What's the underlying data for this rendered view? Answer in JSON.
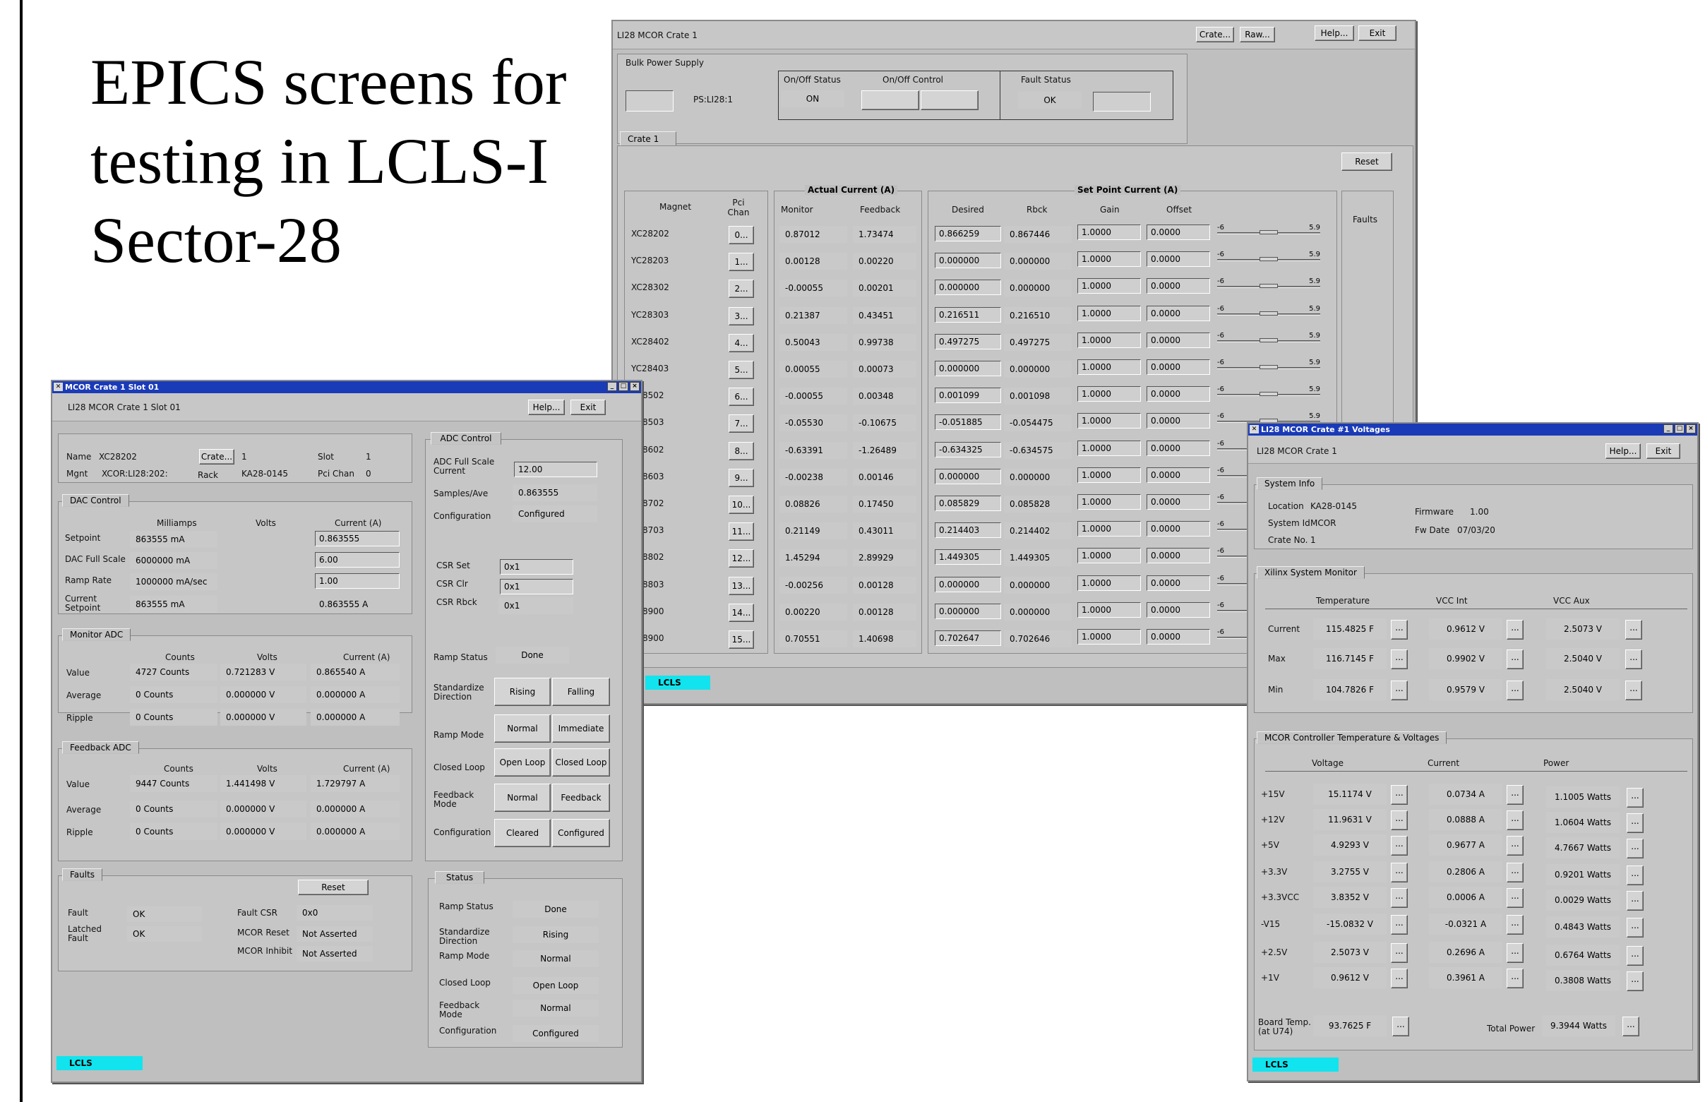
{
  "slide": {
    "title_lines": [
      "EPICS screens for",
      "testing in LCLS-I",
      "Sector-28"
    ]
  },
  "crate": {
    "title": "LI28 MCOR Crate 1",
    "buttons": [
      "Crate...",
      "Raw...",
      "Help...",
      "Exit"
    ],
    "bulk": {
      "label": "Bulk Power Supply",
      "ps_name": "PS:LI28:1",
      "onoff_status_label": "On/Off Status",
      "onoff_control_label": "On/Off Control",
      "fault_status_label": "Fault Status",
      "onoff_status": "ON",
      "fault_status": "OK"
    },
    "tab": "Crate 1",
    "reset": "Reset",
    "headers": {
      "magnet": "Magnet",
      "pci": "Pci Chan",
      "actual": "Actual Current (A)",
      "monitor": "Monitor",
      "feedback": "Feedback",
      "setpoint": "Set Point Current (A)",
      "desired": "Desired",
      "rbck": "Rbck",
      "gain": "Gain",
      "offset": "Offset",
      "faults": "Faults"
    },
    "slider_min": "-6",
    "slider_max": "5.9",
    "rows": [
      {
        "magnet": "XC28202",
        "pci": "0...",
        "mon": "0.87012",
        "fb": "1.73474",
        "des": "0.866259",
        "rbck": "0.867446",
        "gain": "1.0000",
        "off": "0.0000",
        "level": 0.5
      },
      {
        "magnet": "YC28203",
        "pci": "1...",
        "mon": "0.00128",
        "fb": "0.00220",
        "des": "0.000000",
        "rbck": "0.000000",
        "gain": "1.0000",
        "off": "0.0000",
        "level": 0.5
      },
      {
        "magnet": "XC28302",
        "pci": "2...",
        "mon": "-0.00055",
        "fb": "0.00201",
        "des": "0.000000",
        "rbck": "0.000000",
        "gain": "1.0000",
        "off": "0.0000",
        "level": 0.5
      },
      {
        "magnet": "YC28303",
        "pci": "3...",
        "mon": "0.21387",
        "fb": "0.43451",
        "des": "0.216511",
        "rbck": "0.216510",
        "gain": "1.0000",
        "off": "0.0000",
        "level": 0.5
      },
      {
        "magnet": "XC28402",
        "pci": "4...",
        "mon": "0.50043",
        "fb": "0.99738",
        "des": "0.497275",
        "rbck": "0.497275",
        "gain": "1.0000",
        "off": "0.0000",
        "level": 0.5
      },
      {
        "magnet": "YC28403",
        "pci": "5...",
        "mon": "0.00055",
        "fb": "0.00073",
        "des": "0.000000",
        "rbck": "0.000000",
        "gain": "1.0000",
        "off": "0.0000",
        "level": 0.5
      },
      {
        "magnet": "C28502",
        "pci": "6...",
        "mon": "-0.00055",
        "fb": "0.00348",
        "des": "0.001099",
        "rbck": "0.001098",
        "gain": "1.0000",
        "off": "0.0000",
        "level": 0.5
      },
      {
        "magnet": "C28503",
        "pci": "7...",
        "mon": "-0.05530",
        "fb": "-0.10675",
        "des": "-0.051885",
        "rbck": "-0.054475",
        "gain": "1.0000",
        "off": "0.0000",
        "level": 0.5
      },
      {
        "magnet": "C28602",
        "pci": "8...",
        "mon": "-0.63391",
        "fb": "-1.26489",
        "des": "-0.634325",
        "rbck": "-0.634575",
        "gain": "1.0000",
        "off": "0.0000",
        "level": 0.5
      },
      {
        "magnet": "C28603",
        "pci": "9...",
        "mon": "-0.00238",
        "fb": "0.00146",
        "des": "0.000000",
        "rbck": "0.000000",
        "gain": "1.0000",
        "off": "0.0000",
        "level": 0.5
      },
      {
        "magnet": "C28702",
        "pci": "10...",
        "mon": "0.08826",
        "fb": "0.17450",
        "des": "0.085829",
        "rbck": "0.085828",
        "gain": "1.0000",
        "off": "0.0000",
        "level": 0.5
      },
      {
        "magnet": "C28703",
        "pci": "11...",
        "mon": "0.21149",
        "fb": "0.43011",
        "des": "0.214403",
        "rbck": "0.214402",
        "gain": "1.0000",
        "off": "0.0000",
        "level": 0.5
      },
      {
        "magnet": "C28802",
        "pci": "12...",
        "mon": "1.45294",
        "fb": "2.89929",
        "des": "1.449305",
        "rbck": "1.449305",
        "gain": "1.0000",
        "off": "0.0000",
        "level": 0.5
      },
      {
        "magnet": "C28803",
        "pci": "13...",
        "mon": "-0.00256",
        "fb": "0.00128",
        "des": "0.000000",
        "rbck": "0.000000",
        "gain": "1.0000",
        "off": "0.0000",
        "level": 0.5
      },
      {
        "magnet": "C28900",
        "pci": "14...",
        "mon": "0.00220",
        "fb": "0.00128",
        "des": "0.000000",
        "rbck": "0.000000",
        "gain": "1.0000",
        "off": "0.0000",
        "level": 0.5
      },
      {
        "magnet": "C28900",
        "pci": "15...",
        "mon": "0.70551",
        "fb": "1.40698",
        "des": "0.702647",
        "rbck": "0.702646",
        "gain": "1.0000",
        "off": "0.0000",
        "level": 0.5
      }
    ],
    "lcls": "LCLS"
  },
  "slot": {
    "window_title": "MCOR Crate 1 Slot 01",
    "title": "LI28 MCOR Crate 1 Slot 01",
    "help": "Help...",
    "exit": "Exit",
    "info": {
      "name_label": "Name",
      "name": "XC28202",
      "crate_btn": "Crate...",
      "crate_no": "1",
      "slot_label": "Slot",
      "slot": "1",
      "mgnt_label": "Mgnt",
      "mgnt": "XCOR:LI28:202:",
      "rack_label": "Rack",
      "rack": "KA28-0145",
      "pci_label": "Pci Chan",
      "pci": "0"
    },
    "dac": {
      "tab": "DAC Control",
      "col_ma": "Milliamps",
      "col_v": "Volts",
      "col_a": "Current (A)",
      "rows": [
        {
          "label": "Setpoint",
          "ma": "863555 mA",
          "a": "0.863555",
          "a_entry": true
        },
        {
          "label": "DAC Full Scale",
          "ma": "6000000 mA",
          "a": "6.00",
          "a_entry": true
        },
        {
          "label": "Ramp Rate",
          "ma": "1000000 mA/sec",
          "a": "1.00",
          "a_entry": true
        },
        {
          "label": "Current Setpoint",
          "ma": "863555 mA",
          "a": "0.863555 A",
          "a_entry": false
        }
      ]
    },
    "mon": {
      "tab": "Monitor ADC",
      "col_c": "Counts",
      "col_v": "Volts",
      "col_a": "Current (A)",
      "rows": [
        {
          "label": "Value",
          "c": "4727 Counts",
          "v": "0.721283 V",
          "a": "0.865540 A"
        },
        {
          "label": "Average",
          "c": "0 Counts",
          "v": "0.000000 V",
          "a": "0.000000 A"
        },
        {
          "label": "Ripple",
          "c": "0 Counts",
          "v": "0.000000 V",
          "a": "0.000000 A"
        }
      ]
    },
    "fbk": {
      "tab": "Feedback ADC",
      "col_c": "Counts",
      "col_v": "Volts",
      "col_a": "Current (A)",
      "rows": [
        {
          "label": "Value",
          "c": "9447 Counts",
          "v": "1.441498 V",
          "a": "1.729797 A"
        },
        {
          "label": "Average",
          "c": "0 Counts",
          "v": "0.000000 V",
          "a": "0.000000 A"
        },
        {
          "label": "Ripple",
          "c": "0 Counts",
          "v": "0.000000 V",
          "a": "0.000000 A"
        }
      ]
    },
    "faults": {
      "tab": "Faults",
      "reset": "Reset",
      "fault_label": "Fault",
      "fault": "OK",
      "latched_label": "Latched Fault",
      "latched": "OK",
      "csr_label": "Fault CSR",
      "csr": "0x0",
      "reset_label": "MCOR Reset",
      "reset_val": "Not Asserted",
      "inhibit_label": "MCOR Inhibit",
      "inhibit_val": "Not Asserted"
    },
    "adc": {
      "tab": "ADC Control",
      "fs_label": "ADC Full Scale Current",
      "fs": "12.00",
      "samples_label": "Samples/Ave",
      "samples": "0.863555",
      "config_label": "Configuration",
      "config": "Configured",
      "csr_set_label": "CSR Set",
      "csr_set": "0x1",
      "csr_clr_label": "CSR Clr",
      "csr_clr": "0x1",
      "csr_rbck_label": "CSR Rbck",
      "csr_rbck": "0x1",
      "ramp_status_label": "Ramp Status",
      "ramp_status": "Done",
      "std_label": "Standardize Direction",
      "std_a": "Rising",
      "std_b": "Falling",
      "ramp_mode_label": "Ramp Mode",
      "ramp_a": "Normal",
      "ramp_b": "Immediate",
      "cl_label": "Closed Loop",
      "cl_a": "Open Loop",
      "cl_b": "Closed Loop",
      "fbm_label": "Feedback Mode",
      "fbm_a": "Normal",
      "fbm_b": "Feedback",
      "cfg_label": "Configuration",
      "cfg_a": "Cleared",
      "cfg_b": "Configured"
    },
    "status": {
      "tab": "Status",
      "rows": [
        {
          "label": "Ramp Status",
          "val": "Done"
        },
        {
          "label": "Standardize Direction",
          "val": "Rising"
        },
        {
          "label": "Ramp Mode",
          "val": "Normal"
        },
        {
          "label": "Closed Loop",
          "val": "Open Loop"
        },
        {
          "label": "Feedback Mode",
          "val": "Normal"
        },
        {
          "label": "Configuration",
          "val": "Configured"
        }
      ]
    },
    "lcls": "LCLS"
  },
  "volt": {
    "window_title": "LI28 MCOR Crate #1 Voltages",
    "title": "LI28 MCOR Crate 1",
    "help": "Help...",
    "exit": "Exit",
    "sys": {
      "tab": "System Info",
      "loc_label": "Location",
      "loc": "KA28-0145",
      "sysid_label": "System Id",
      "sysid": "MCOR",
      "crate_label": "Crate No.",
      "crate": "1",
      "fw_label": "Firmware",
      "fw": "1.00",
      "fwdate_label": "Fw Date",
      "fwdate": "07/03/20"
    },
    "xmon": {
      "tab": "Xilinx System Monitor",
      "col_t": "Temperature",
      "col_vi": "VCC Int",
      "col_va": "VCC Aux",
      "rows": [
        {
          "label": "Current",
          "t": "115.4825 F",
          "vi": "0.9612 V",
          "va": "2.5073 V"
        },
        {
          "label": "Max",
          "t": "116.7145 F",
          "vi": "0.9902 V",
          "va": "2.5040 V"
        },
        {
          "label": "Min",
          "t": "104.7826 F",
          "vi": "0.9579 V",
          "va": "2.5040 V"
        }
      ]
    },
    "ctrl": {
      "tab": "MCOR Controller Temperature & Voltages",
      "col_v": "Voltage",
      "col_c": "Current",
      "col_p": "Power",
      "rows": [
        {
          "label": "+15V",
          "v": "15.1174 V",
          "c": "0.0734 A",
          "p": "1.1005 Watts"
        },
        {
          "label": "+12V",
          "v": "11.9631 V",
          "c": "0.0888 A",
          "p": "1.0604 Watts"
        },
        {
          "label": "+5V",
          "v": "4.9293 V",
          "c": "0.9677 A",
          "p": "4.7667 Watts"
        },
        {
          "label": "+3.3V",
          "v": "3.2755 V",
          "c": "0.2806 A",
          "p": "0.9201 Watts"
        },
        {
          "label": "+3.3VCC",
          "v": "3.8352 V",
          "c": "0.0006 A",
          "p": "0.0029 Watts"
        },
        {
          "label": "-V15",
          "v": "-15.0832 V",
          "c": "-0.0321 A",
          "p": "0.4843 Watts"
        },
        {
          "label": "+2.5V",
          "v": "2.5073 V",
          "c": "0.2696 A",
          "p": "0.6764 Watts"
        },
        {
          "label": "+1V",
          "v": "0.9612 V",
          "c": "0.3961 A",
          "p": "0.3808 Watts"
        }
      ],
      "board_label": "Board Temp. (at U74)",
      "board": "93.7625 F",
      "total_label": "Total Power",
      "total": "9.3944 Watts"
    },
    "dots": "...",
    "lcls": "LCLS"
  }
}
